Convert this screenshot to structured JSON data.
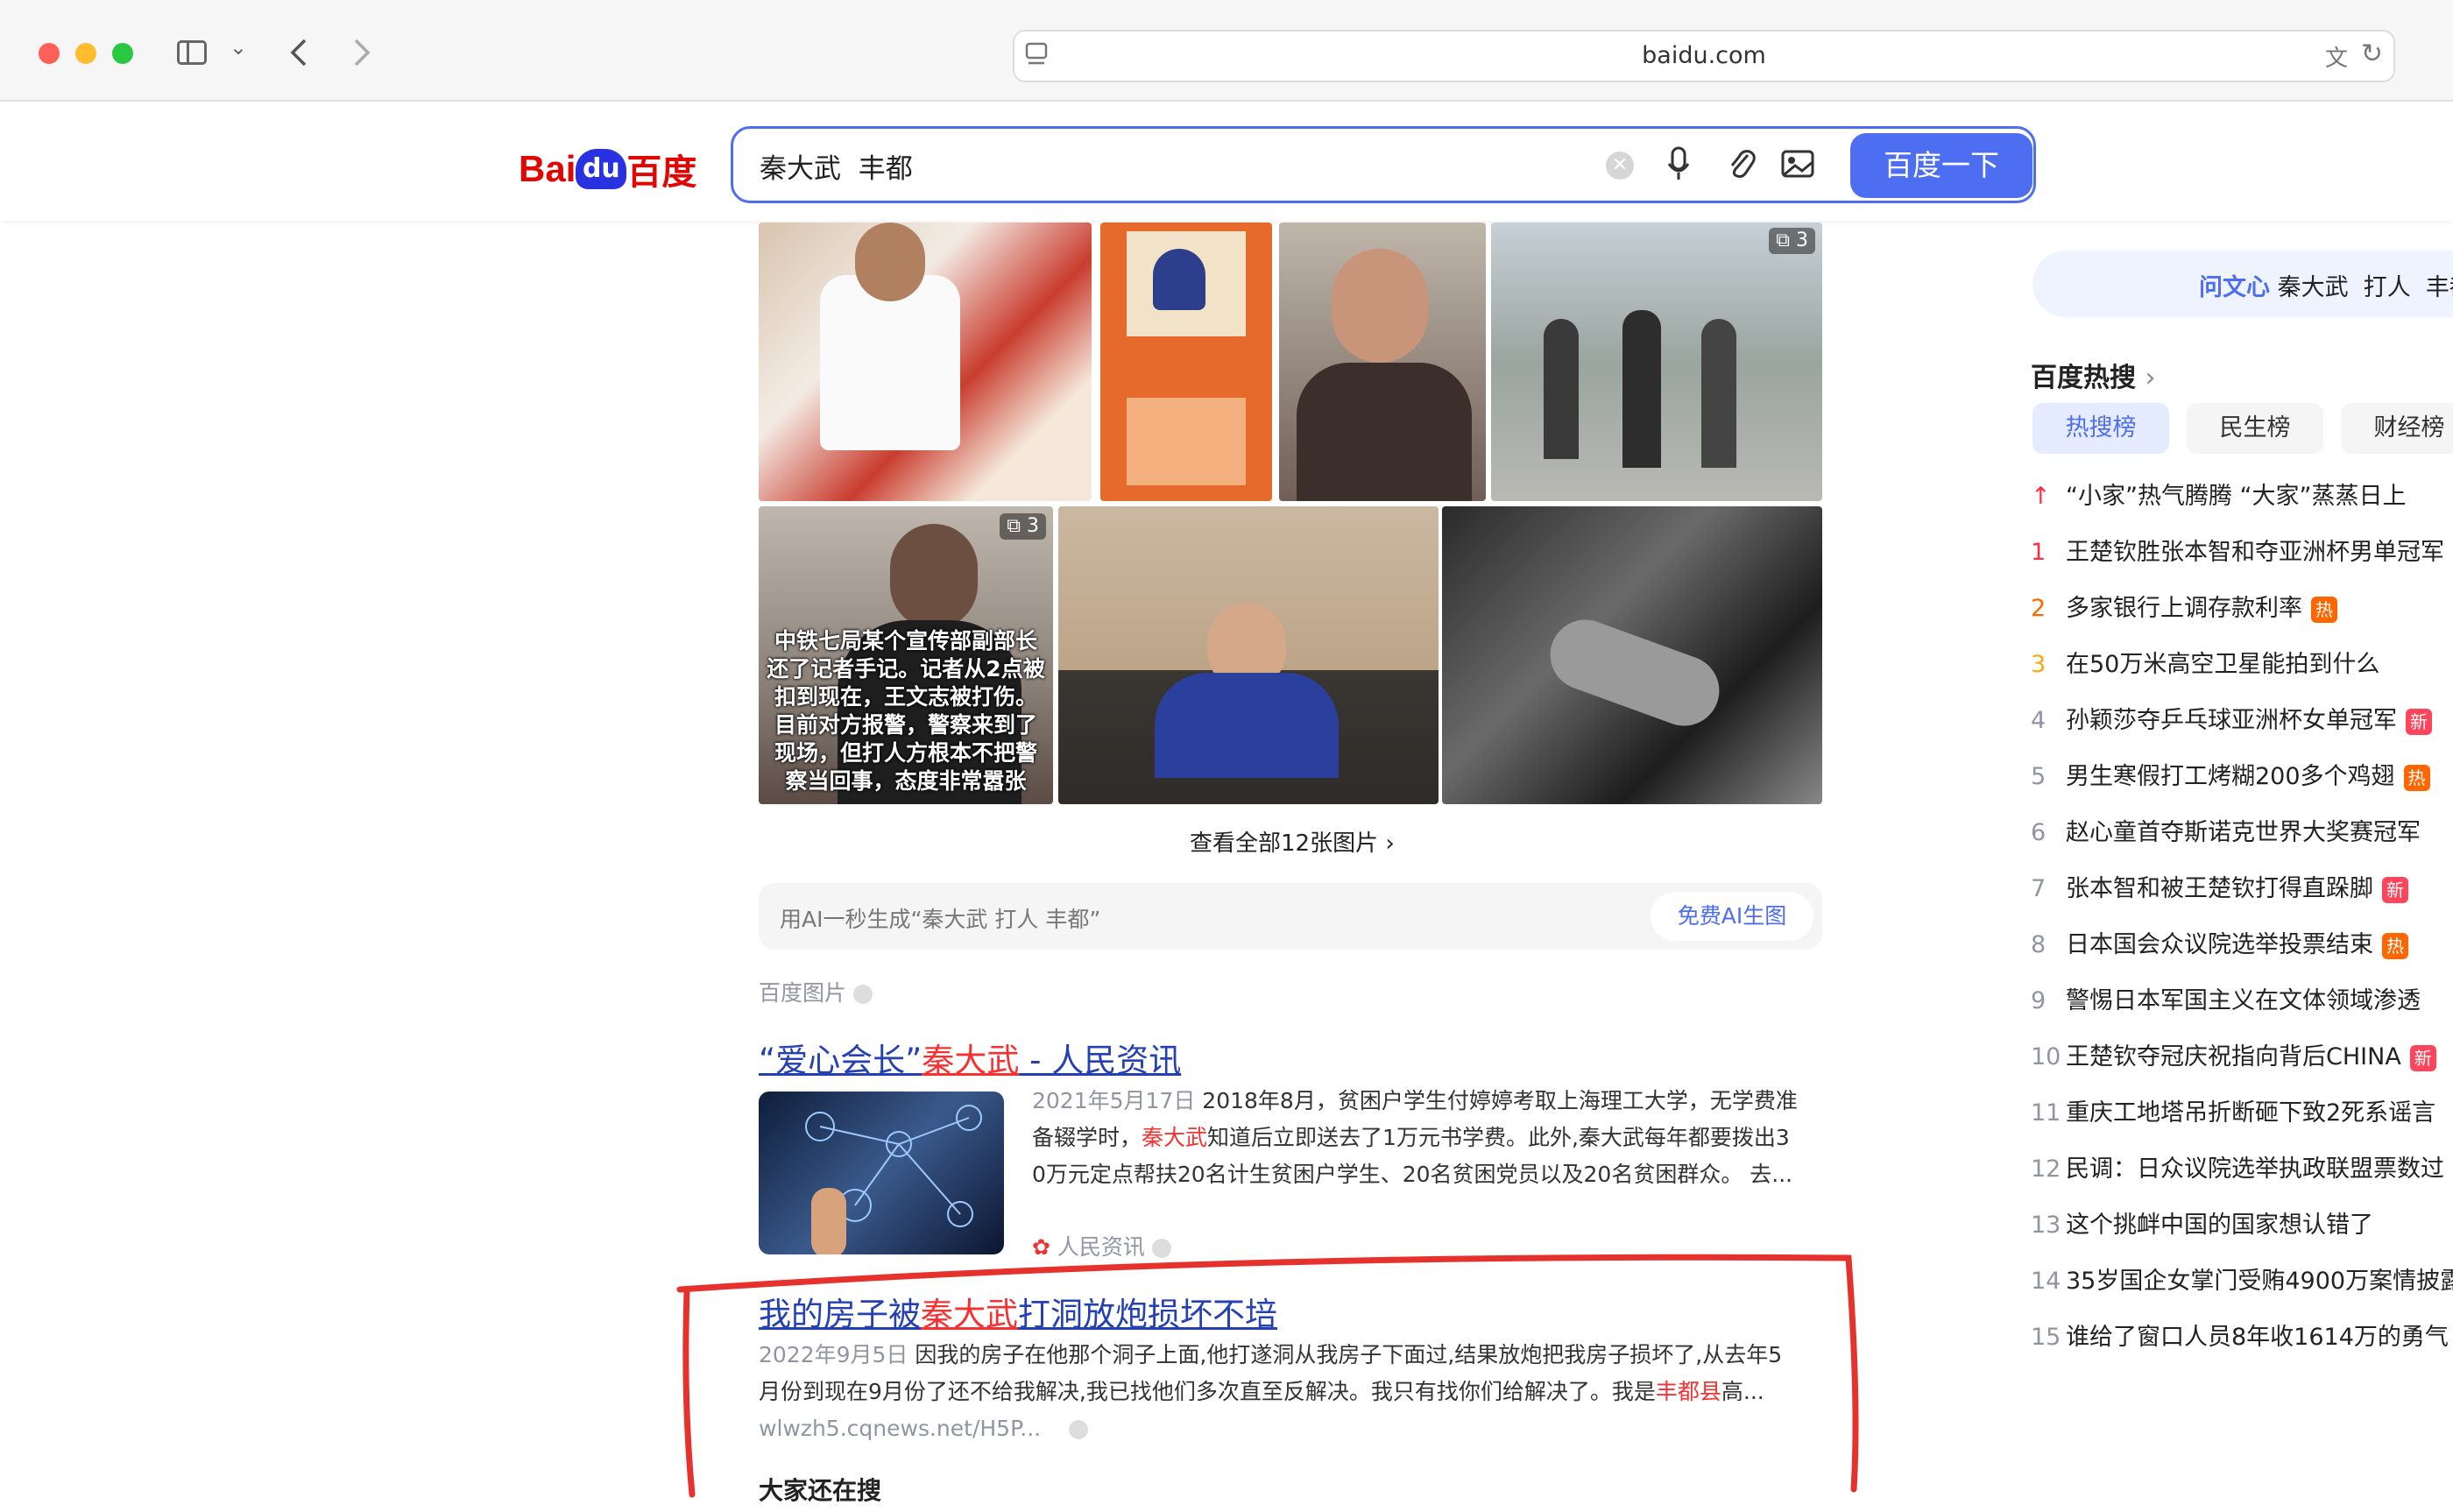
{
  "browser": {
    "url": "baidu.com"
  },
  "search": {
    "query": "秦大武  丰都",
    "button_label": "百度一下"
  },
  "logo": {
    "text_bai": "Bai",
    "text_du": "du",
    "text_cn": "百度"
  },
  "image_gallery": {
    "caption_text": "中铁七局某个宣传部副部长还了记者手记。记者从2点被扣到现在，王文志被打伤。目前对方报警，警察来到了现场，但打人方根本不把警察当回事，态度非常嚣张",
    "badge_count_1": "3",
    "badge_count_2": "3",
    "view_all": "查看全部12张图片",
    "ai_prompt": "用AI一秒生成“秦大武 打人 丰都”",
    "ai_button": "免费AI生图",
    "source": "百度图片"
  },
  "results": [
    {
      "title_pre": "“爱心会长”",
      "title_hl": "秦大武",
      "title_post": " - 人民资讯",
      "date": "2021年5月17日",
      "line1": "2018年8月，贫困户学生付婷婷考取上海理工大学，无学费准",
      "line2_pre": "备辍学时，",
      "line2_hl": "秦大武",
      "line2_post": "知道后立即送去了1万元书学费。此外,秦大武每年都要拨出3",
      "line3": "0万元定点帮扶20名计生贫困户学生、20名贫困党员以及20名贫困群众。 去...",
      "source": "人民资讯"
    },
    {
      "title_pre": "我的房子被",
      "title_hl": "秦大武",
      "title_post": "打洞放炮损坏不培",
      "date": "2022年9月5日",
      "line1": "因我的房子在他那个洞子上面,他打遂洞从我房子下面过,结果放炮把我房子损坏了,从去年5",
      "line2_pre": "月份到现在9月份了还不给我解决,我已找他们多次直至反解决。我只有找你们给解决了。我是",
      "line2_hl": "丰都县",
      "line2_post": "高...",
      "url": "wlwzh5.cqnews.net/H5P..."
    }
  ],
  "also_search": "大家还在搜",
  "sidebar": {
    "wenxin_brand": "问文心",
    "wenxin_query": "秦大武  打人  丰都",
    "hot_title": "百度热搜",
    "tabs": [
      "热搜榜",
      "民生榜",
      "财经榜"
    ],
    "items": [
      {
        "rank": "",
        "title": "“小家”热气腾腾 “大家”蒸蒸日上",
        "tag": ""
      },
      {
        "rank": "1",
        "title": "王楚钦胜张本智和夺亚洲杯男单冠军",
        "tag": ""
      },
      {
        "rank": "2",
        "title": "多家银行上调存款利率",
        "tag": "热"
      },
      {
        "rank": "3",
        "title": "在50万米高空卫星能拍到什么",
        "tag": ""
      },
      {
        "rank": "4",
        "title": "孙颖莎夺乒乓球亚洲杯女单冠军",
        "tag": "新"
      },
      {
        "rank": "5",
        "title": "男生寒假打工烤糊200多个鸡翅",
        "tag": "热"
      },
      {
        "rank": "6",
        "title": "赵心童首夺斯诺克世界大奖赛冠军",
        "tag": ""
      },
      {
        "rank": "7",
        "title": "张本智和被王楚钦打得直跺脚",
        "tag": "新"
      },
      {
        "rank": "8",
        "title": "日本国会众议院选举投票结束",
        "tag": "热"
      },
      {
        "rank": "9",
        "title": "警惕日本军国主义在文体领域渗透",
        "tag": ""
      },
      {
        "rank": "10",
        "title": "王楚钦夺冠庆祝指向背后CHINA",
        "tag": "新"
      },
      {
        "rank": "11",
        "title": "重庆工地塔吊折断砸下致2死系谣言",
        "tag": ""
      },
      {
        "rank": "12",
        "title": "民调：日众议院选举执政联盟票数过",
        "tag": ""
      },
      {
        "rank": "13",
        "title": "这个挑衅中国的国家想认错了",
        "tag": ""
      },
      {
        "rank": "14",
        "title": "35岁国企女掌门受贿4900万案情披露",
        "tag": ""
      },
      {
        "rank": "15",
        "title": "谁给了窗口人员8年收1614万的勇气",
        "tag": ""
      }
    ]
  },
  "colors": {
    "accent": "#4e6ef2",
    "link": "#2440b3",
    "highlight": "#f73131",
    "annotation": "#e5322d"
  }
}
